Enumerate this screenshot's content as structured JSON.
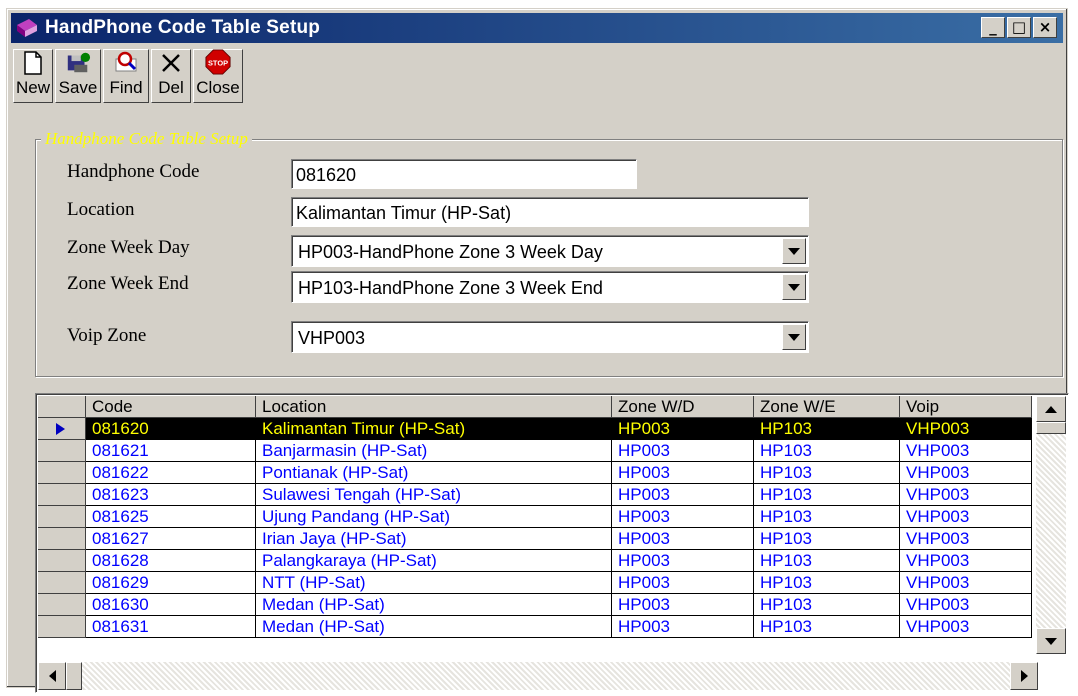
{
  "window": {
    "title": "HandPhone Code Table Setup",
    "controls": [
      "_",
      "□",
      "×"
    ]
  },
  "toolbar": {
    "buttons": [
      {
        "label": "New",
        "icon": "new-document-icon"
      },
      {
        "label": "Save",
        "icon": "save-icon"
      },
      {
        "label": "Find",
        "icon": "magnifier-icon"
      },
      {
        "label": "Del",
        "icon": "delete-x-icon"
      },
      {
        "label": "Close",
        "icon": "stop-sign-icon",
        "icon_text": "STOP"
      }
    ]
  },
  "form": {
    "legend": "Handphone  Code Table Setup",
    "handphone_code_label": "Handphone Code",
    "handphone_code_value": "081620",
    "location_label": "Location",
    "location_value": "Kalimantan Timur (HP-Sat)",
    "zone_week_day_label": "Zone Week Day",
    "zone_week_day_value": "HP003-HandPhone Zone 3 Week Day",
    "zone_week_end_label": "Zone Week End",
    "zone_week_end_value": "HP103-HandPhone Zone 3 Week End",
    "voip_zone_label": "Voip Zone",
    "voip_zone_value": "VHP003"
  },
  "table": {
    "columns": [
      "Code",
      "Location",
      "Zone W/D",
      "Zone W/E",
      "Voip"
    ],
    "rows": [
      [
        "081620",
        "Kalimantan Timur (HP-Sat)",
        "HP003",
        "HP103",
        "VHP003"
      ],
      [
        "081621",
        "Banjarmasin (HP-Sat)",
        "HP003",
        "HP103",
        "VHP003"
      ],
      [
        "081622",
        "Pontianak (HP-Sat)",
        "HP003",
        "HP103",
        "VHP003"
      ],
      [
        "081623",
        "Sulawesi Tengah  (HP-Sat)",
        "HP003",
        "HP103",
        "VHP003"
      ],
      [
        "081625",
        "Ujung Pandang  (HP-Sat)",
        "HP003",
        "HP103",
        "VHP003"
      ],
      [
        "081627",
        "Irian Jaya (HP-Sat)",
        "HP003",
        "HP103",
        "VHP003"
      ],
      [
        "081628",
        "Palangkaraya (HP-Sat)",
        "HP003",
        "HP103",
        "VHP003"
      ],
      [
        "081629",
        "NTT  (HP-Sat)",
        "HP003",
        "HP103",
        "VHP003"
      ],
      [
        "081630",
        "Medan (HP-Sat)",
        "HP003",
        "HP103",
        "VHP003"
      ],
      [
        "081631",
        "Medan (HP-Sat)",
        "HP003",
        "HP103",
        "VHP003"
      ]
    ],
    "selected_row": 0
  },
  "colors": {
    "title_gradient_start": "#0a246a",
    "title_gradient_end": "#3a6ea5",
    "legend_text": "#ffff00",
    "row_text": "#0000ff",
    "selected_bg": "#000000",
    "selected_text": "#ffff00"
  }
}
